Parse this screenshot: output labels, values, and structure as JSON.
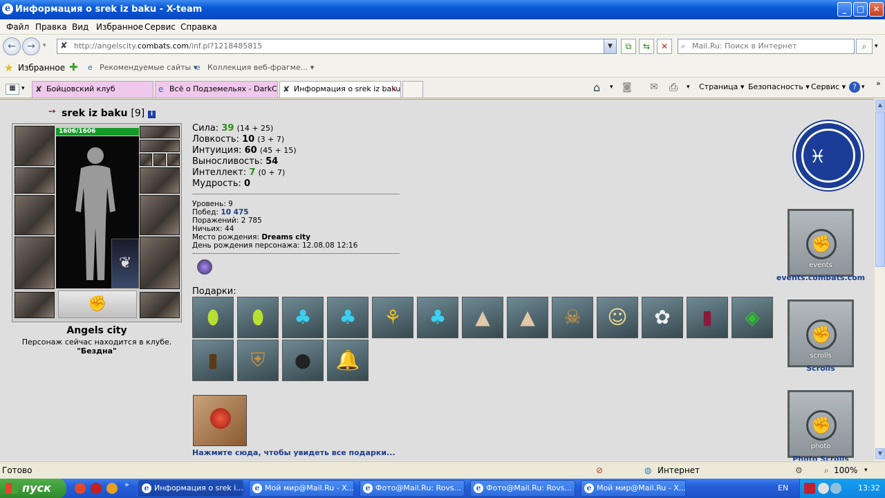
{
  "window": {
    "title": "Информация о srek iz baku - X-team",
    "min": "_",
    "max": "□",
    "close": "✕"
  },
  "menu": [
    "Файл",
    "Правка",
    "Вид",
    "Избранное",
    "Сервис",
    "Справка"
  ],
  "address": {
    "prefix": "http://angelscity.",
    "domain": "combats.com",
    "path": "/inf.pl?1218485815"
  },
  "search_placeholder": "Mail.Ru: Поиск в Интернет",
  "favbar": {
    "favorites": "Избранное",
    "recommended": "Рекомендуемые сайты ▾",
    "gallery": "Коллекция веб-фрагме... ▾"
  },
  "tabs": [
    {
      "label": "Бойцовский клуб"
    },
    {
      "label": "Всё о Подземельях - DarkCl..."
    },
    {
      "label": "Информация о srek iz baku"
    }
  ],
  "commands": {
    "page": "Страница ▾",
    "security": "Безопасность ▾",
    "service": "Сервис ▾"
  },
  "character": {
    "name": "srek iz baku",
    "level": "[9]",
    "hp": "1606/1606",
    "city": "Angels city",
    "location_line": "Персонаж сейчас находится в клубе.",
    "location_room": "\"Бездна\""
  },
  "stats": [
    {
      "label": "Сила:",
      "value": "39",
      "extra": "(14 + 25)",
      "green": true
    },
    {
      "label": "Ловкость:",
      "value": "10",
      "extra": "(3 + 7)",
      "green": false
    },
    {
      "label": "Интуиция:",
      "value": "60",
      "extra": "(45 + 15)",
      "green": false
    },
    {
      "label": "Выносливость:",
      "value": "54",
      "extra": "",
      "green": false
    },
    {
      "label": "Интеллект:",
      "value": "7",
      "extra": "(0 + 7)",
      "green": true
    },
    {
      "label": "Мудрость:",
      "value": "0",
      "extra": "",
      "green": false
    }
  ],
  "info": {
    "level_label": "Уровень:",
    "level": "9",
    "wins_label": "Побед:",
    "wins": "10 475",
    "losses_label": "Поражений:",
    "losses": "2 785",
    "draws_label": "Ничьих:",
    "draws": "44",
    "birthplace_label": "Место рождения:",
    "birthplace": "Dreams city",
    "birthday_label": "День рождения персонажа:",
    "birthday": "12.08.08 12:16"
  },
  "gifts_label": "Подарки:",
  "gifts_more": "Нажмите сюда, чтобы увидеть все подарки...",
  "side_links": {
    "events": "events.combats.com",
    "scrolls": "Scrolls",
    "photo": "Photo Scrolls",
    "events_banner": "events",
    "scrolls_banner": "scrolls",
    "photo_banner": "photo"
  },
  "status": {
    "ready": "Готово",
    "zone": "Интернет",
    "zoom": "100%"
  },
  "taskbar": {
    "start": "пуск",
    "items": [
      "Информация о srek i...",
      "Мой мир@Mail.Ru - X...",
      "Фото@Mail.Ru: Rovs...",
      "Фото@Mail.Ru: Rovs...",
      "Мой мир@Mail.Ru - X..."
    ],
    "lang": "EN",
    "time": "13:32"
  }
}
